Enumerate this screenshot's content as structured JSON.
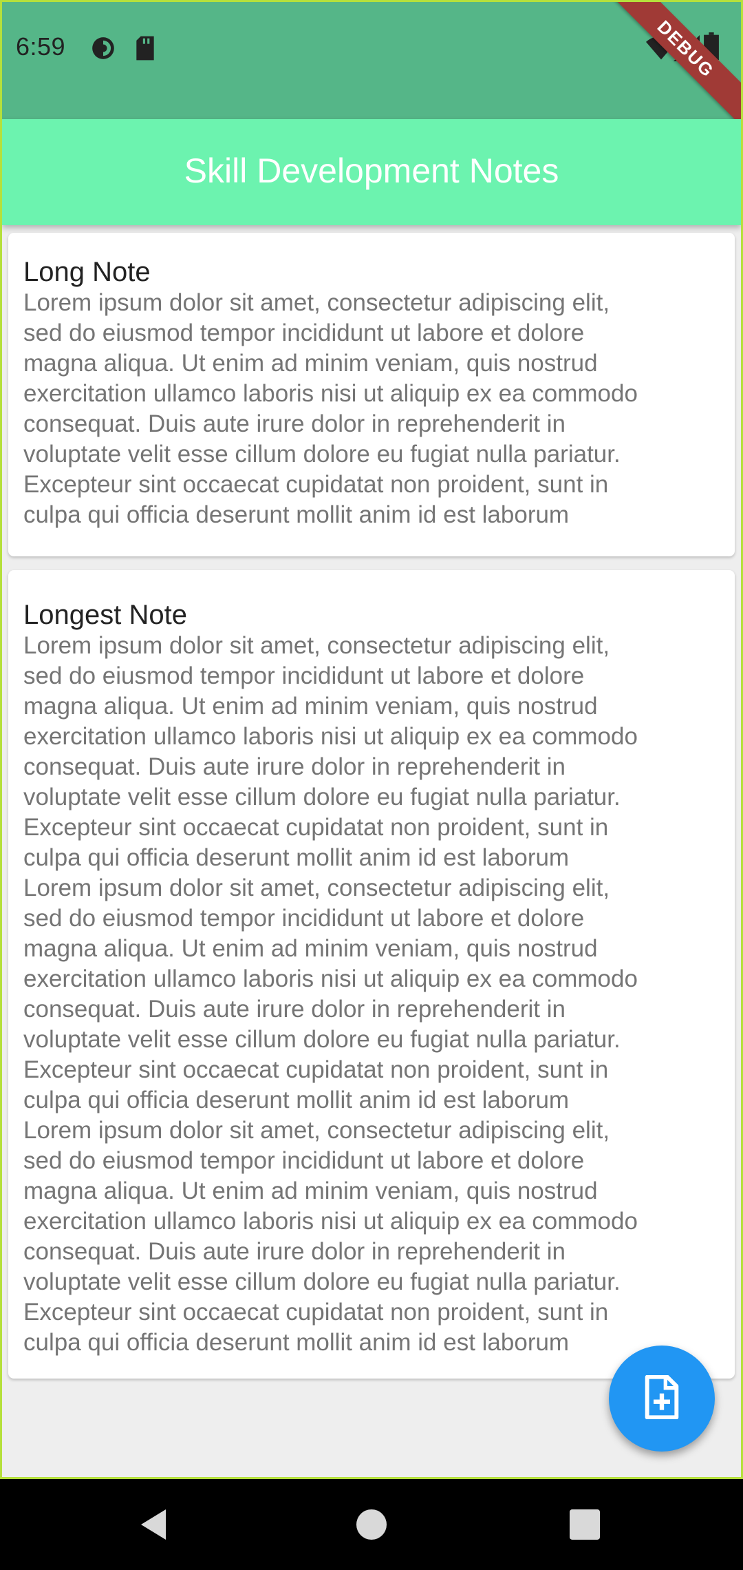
{
  "status_bar": {
    "time": "6:59",
    "debug_label": "DEBUG",
    "icons": [
      "data-saver-icon",
      "sd-card-icon",
      "wifi-icon",
      "signal-icon",
      "battery-icon"
    ]
  },
  "app_bar": {
    "title": "Skill Development Notes"
  },
  "notes": [
    {
      "title": "Long Note",
      "body": "Lorem ipsum dolor sit amet, consectetur adipiscing elit,\nsed do eiusmod tempor incididunt ut labore et dolore\nmagna aliqua. Ut enim ad minim veniam, quis nostrud\nexercitation ullamco laboris nisi ut aliquip ex ea commodo\nconsequat. Duis aute irure dolor in reprehenderit in\nvoluptate velit esse cillum dolore eu fugiat nulla pariatur.\nExcepteur sint occaecat cupidatat non proident, sunt in\nculpa qui officia deserunt mollit anim id est laborum"
    },
    {
      "title": "Longest Note",
      "body": "Lorem ipsum dolor sit amet, consectetur adipiscing elit,\nsed do eiusmod tempor incididunt ut labore et dolore\nmagna aliqua. Ut enim ad minim veniam, quis nostrud\nexercitation ullamco laboris nisi ut aliquip ex ea commodo\nconsequat. Duis aute irure dolor in reprehenderit in\nvoluptate velit esse cillum dolore eu fugiat nulla pariatur.\nExcepteur sint occaecat cupidatat non proident, sunt in\nculpa qui officia deserunt mollit anim id est laborum\nLorem ipsum dolor sit amet, consectetur adipiscing elit,\nsed do eiusmod tempor incididunt ut labore et dolore\nmagna aliqua. Ut enim ad minim veniam, quis nostrud\nexercitation ullamco laboris nisi ut aliquip ex ea commodo\nconsequat. Duis aute irure dolor in reprehenderit in\nvoluptate velit esse cillum dolore eu fugiat nulla pariatur.\nExcepteur sint occaecat cupidatat non proident, sunt in\nculpa qui officia deserunt mollit anim id est laborum\nLorem ipsum dolor sit amet, consectetur adipiscing elit,\nsed do eiusmod tempor incididunt ut labore et dolore\nmagna aliqua. Ut enim ad minim veniam, quis nostrud\nexercitation ullamco laboris nisi ut aliquip ex ea commodo\nconsequat. Duis aute irure dolor in reprehenderit in\nvoluptate velit esse cillum dolore eu fugiat nulla pariatur.\nExcepteur sint occaecat cupidatat non proident, sunt in\nculpa qui officia deserunt mollit anim id est laborum"
    }
  ],
  "fab": {
    "icon": "note-add-icon"
  },
  "nav_bar": {
    "icons": [
      "back-icon",
      "home-icon",
      "recents-icon"
    ]
  },
  "colors": {
    "status_bar": "#55b688",
    "app_bar": "#6cf3af",
    "background": "#eeeeee",
    "fab": "#2196f3",
    "debug_banner": "#a03a36"
  }
}
